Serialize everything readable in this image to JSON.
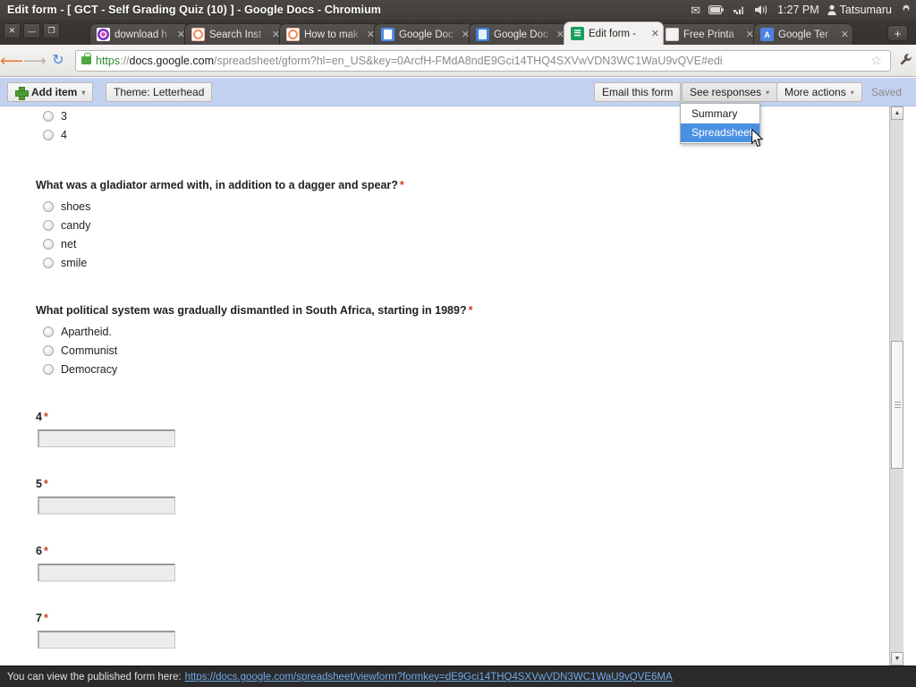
{
  "window": {
    "title": "Edit form - [ GCT - Self Grading Quiz (10) ] - Google Docs - Chromium",
    "close_label": "✕",
    "minimize_label": "—",
    "maximize_label": "❐"
  },
  "systray": {
    "mail_icon": "envelope-icon",
    "battery_icon": "battery-icon",
    "network_icon": "network-signal-icon",
    "volume_icon": "volume-icon",
    "time": "1:27 PM",
    "user": "Tatsumaru",
    "gear_icon": "gear-icon"
  },
  "tabs": [
    {
      "label": "download h",
      "favicon": "download-icon",
      "active": false
    },
    {
      "label": "Search Inst",
      "favicon": "orange-circle-icon",
      "active": false
    },
    {
      "label": "How to mak",
      "favicon": "orange-circle-icon",
      "active": false
    },
    {
      "label": "Google Doc",
      "favicon": "google-docs-icon",
      "active": false
    },
    {
      "label": "Google Doc",
      "favicon": "google-docs-icon",
      "active": false
    },
    {
      "label": "Edit form -",
      "favicon": "google-forms-icon",
      "active": true
    },
    {
      "label": "Free Printa",
      "favicon": "blank-page-icon",
      "active": false
    },
    {
      "label": "Google Ter",
      "favicon": "google-translate-icon",
      "active": false
    }
  ],
  "newtab_label": "+",
  "browser": {
    "back_icon": "back-arrow-icon",
    "forward_icon": "forward-arrow-icon",
    "reload_icon": "reload-icon",
    "lock_icon": "lock-icon",
    "url_scheme": "https",
    "url_scheme_sep": "://",
    "url_host": "docs.google.com",
    "url_path": "/spreadsheet/gform?hl=en_US&key=0ArcfH-FMdA8ndE9Gci14THQ4SXVwVDN3WC1WaU9vQVE#edi",
    "star_icon": "star-icon",
    "wrench_icon": "wrench-icon"
  },
  "toolbar": {
    "add_item_label": "Add item",
    "add_item_caret": "▾",
    "theme_label": "Theme:  Letterhead",
    "email_form_label": "Email this form",
    "see_responses_label": "See responses",
    "see_responses_caret": "▾",
    "more_actions_label": "More actions",
    "more_actions_caret": "▾",
    "saved_label": "Saved"
  },
  "dropdown": {
    "items": [
      {
        "label": "Summary",
        "selected": false
      },
      {
        "label": "Spreadsheet",
        "selected": true
      }
    ]
  },
  "form": {
    "partial_options": [
      {
        "label": "3"
      },
      {
        "label": "4"
      }
    ],
    "questions": [
      {
        "title": "What was a gladiator armed with, in addition to a dagger and spear?",
        "required": "*",
        "options": [
          "shoes",
          "candy",
          "net",
          "smile"
        ]
      },
      {
        "title": "What political system was gradually dismantled in South Africa, starting in 1989?",
        "required": "*",
        "options": [
          "Apartheid.",
          "Communist",
          "Democracy"
        ]
      }
    ],
    "text_questions": [
      {
        "title": "4",
        "required": "*",
        "value": ""
      },
      {
        "title": "5",
        "required": "*",
        "value": ""
      },
      {
        "title": "6",
        "required": "*",
        "value": ""
      },
      {
        "title": "7",
        "required": "*",
        "value": ""
      }
    ]
  },
  "scrollbar": {
    "up_arrow": "▲",
    "down_arrow": "▼"
  },
  "status": {
    "text": "You can view the published form here:",
    "link": "https://docs.google.com/spreadsheet/viewform?formkey=dE9Gci14THQ4SXVwVDN3WC1WaU9vQVE6MA"
  },
  "colors": {
    "toolbar_bg": "#c3d2f0",
    "accent_blue": "#4a90e2",
    "required_red": "#cc4125",
    "link_blue": "#6fa8e8"
  }
}
